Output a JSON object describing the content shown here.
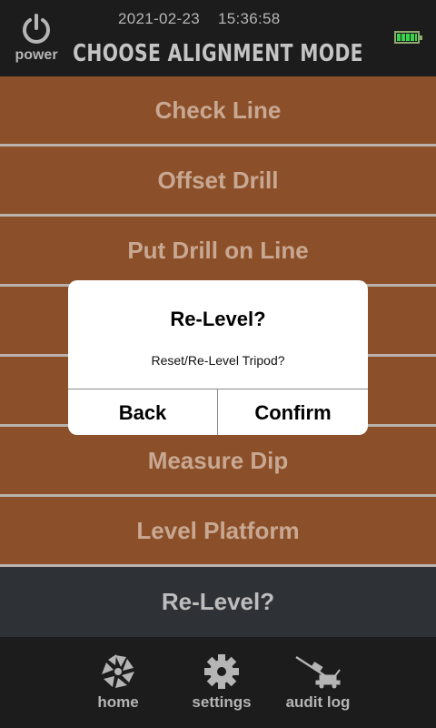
{
  "header": {
    "power_label": "power",
    "date": "2021-02-23",
    "time": "15:36:58",
    "title": "CHOOSE ALIGNMENT MODE",
    "battery_level": 1.0
  },
  "modes": [
    {
      "label": "Check Line"
    },
    {
      "label": "Offset Drill"
    },
    {
      "label": "Put Drill on Line"
    },
    {
      "label": ""
    },
    {
      "label": ""
    },
    {
      "label": "Measure Dip"
    },
    {
      "label": "Level Platform"
    },
    {
      "label": "Re-Level?"
    }
  ],
  "nav": {
    "home": "home",
    "settings": "settings",
    "audit_log": "audit log"
  },
  "dialog": {
    "title": "Re-Level?",
    "message": "Reset/Re-Level Tripod?",
    "back_label": "Back",
    "confirm_label": "Confirm"
  },
  "colors": {
    "mode_bg": "#8b5029",
    "active_bg": "#2e3135",
    "battery_fill": "#37d34a"
  }
}
